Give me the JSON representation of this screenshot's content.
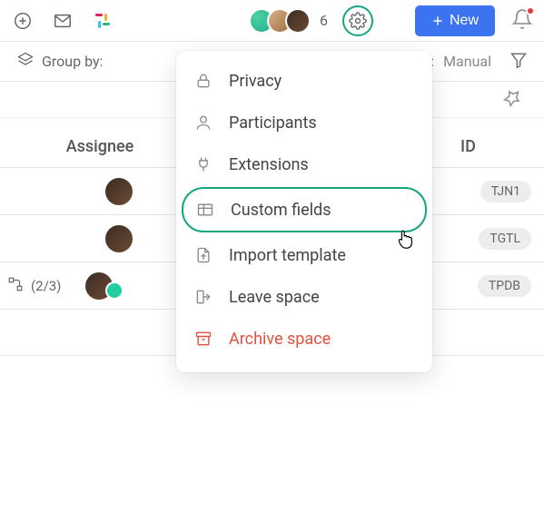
{
  "toolbar": {
    "presence_count": "6",
    "new_button_label": "New"
  },
  "secondary": {
    "group_by_label": "Group by:",
    "sort_prefix": ":",
    "sort_value": "Manual"
  },
  "dropdown": {
    "items": [
      {
        "label": "Privacy"
      },
      {
        "label": "Participants"
      },
      {
        "label": "Extensions"
      },
      {
        "label": "Custom fields"
      },
      {
        "label": "Import template"
      },
      {
        "label": "Leave space"
      },
      {
        "label": "Archive space"
      }
    ]
  },
  "table": {
    "columns": {
      "assignee": "Assignee",
      "id": "ID"
    },
    "rows": [
      {
        "subtask": "",
        "id_badge": "TJN1"
      },
      {
        "subtask": "",
        "id_badge": "TGTL"
      },
      {
        "subtask": "(2/3)",
        "id_badge": "TPDB"
      }
    ]
  }
}
